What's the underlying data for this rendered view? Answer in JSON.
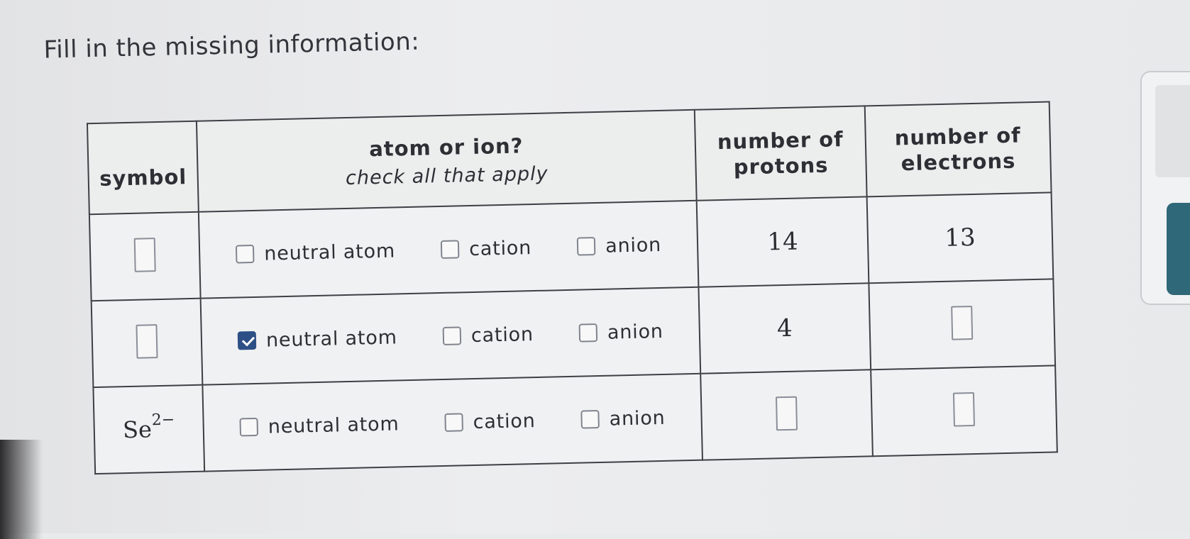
{
  "prompt": "Fill in the missing information:",
  "table": {
    "headers": {
      "symbol": "symbol",
      "atom_or_ion": "atom or ion?",
      "atom_or_ion_sub": "check all that apply",
      "protons": "number of protons",
      "electrons": "number of electrons"
    },
    "rows": [
      {
        "symbol": "",
        "options": [
          {
            "label": "neutral atom",
            "checked": false
          },
          {
            "label": "cation",
            "checked": false
          },
          {
            "label": "anion",
            "checked": false
          }
        ],
        "protons": "14",
        "electrons": "13"
      },
      {
        "symbol": "",
        "options": [
          {
            "label": "neutral atom",
            "checked": true
          },
          {
            "label": "cation",
            "checked": false
          },
          {
            "label": "anion",
            "checked": false
          }
        ],
        "protons": "4",
        "electrons": ""
      },
      {
        "symbol_base": "Se",
        "symbol_charge": "2−",
        "options": [
          {
            "label": "neutral atom",
            "checked": false
          },
          {
            "label": "cation",
            "checked": false
          },
          {
            "label": "anion",
            "checked": false
          }
        ],
        "protons": "",
        "electrons": ""
      }
    ]
  },
  "colors": {
    "checked_box": "#2d4f86",
    "side_button": "#2f6878"
  }
}
